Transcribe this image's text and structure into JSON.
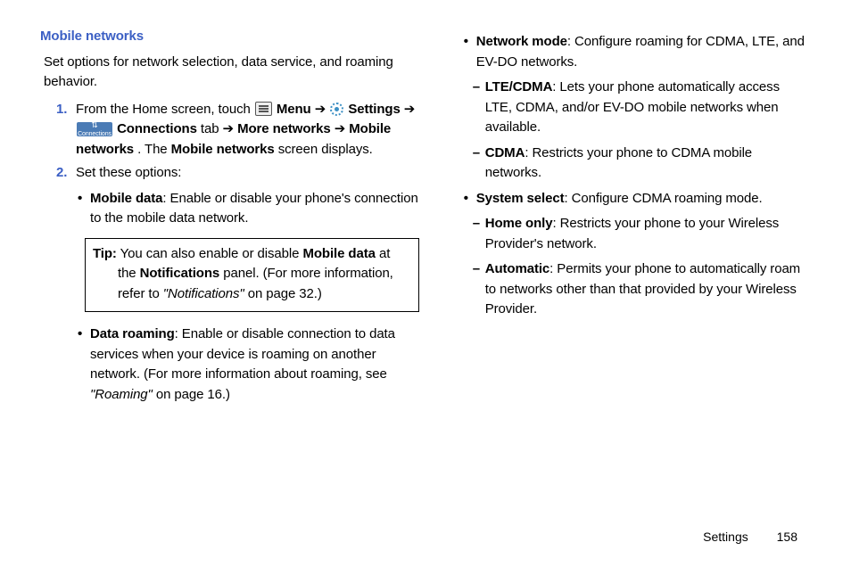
{
  "section_title": "Mobile networks",
  "intro": "Set options for network selection, data service, and roaming behavior.",
  "steps": {
    "s1": {
      "num": "1.",
      "segments": {
        "a": "From the Home screen, touch ",
        "menu": " Menu",
        "arr": " ➔ ",
        "settings": " Settings",
        "conn_tab": " Connections",
        "tab_word": " tab ",
        "more_net": "More networks",
        "mobile_net": "Mobile networks",
        "period": ". The ",
        "mobile_net2": "Mobile networks",
        "tail": " screen displays."
      }
    },
    "s2": {
      "num": "2.",
      "text": "Set these options:"
    }
  },
  "bullets_left": {
    "mobile_data": {
      "label": "Mobile data",
      "desc": ": Enable or disable your phone's connection to the mobile data network."
    },
    "data_roaming": {
      "label": "Data roaming",
      "desc_a": ": Enable or disable connection to data services when your device is roaming on another network. (For more information about roaming, see ",
      "ref": "\"Roaming\"",
      "desc_b": " on page 16.)"
    }
  },
  "tip": {
    "label": "Tip:",
    "text_a": " You can also enable or disable ",
    "bold1": "Mobile data",
    "text_b": " at the ",
    "bold2": "Notifications",
    "text_c": " panel. (For more information, refer to ",
    "ref": "\"Notifications\"",
    "text_d": " on page 32.)"
  },
  "bullets_right": {
    "network_mode": {
      "label": "Network mode",
      "desc": ": Configure roaming for CDMA, LTE, and EV-DO networks."
    },
    "lte_cdma": {
      "label": "LTE/CDMA",
      "desc": ": Lets your phone automatically access LTE, CDMA, and/or EV-DO mobile networks when available."
    },
    "cdma": {
      "label": "CDMA",
      "desc": ": Restricts your phone to CDMA mobile networks."
    },
    "system_select": {
      "label": "System select",
      "desc": ": Configure CDMA roaming mode."
    },
    "home_only": {
      "label": "Home only",
      "desc": ": Restricts your phone to your Wireless Provider's network."
    },
    "automatic": {
      "label": "Automatic",
      "desc": ": Permits your phone to automatically roam to networks other than that provided by your Wireless Provider."
    }
  },
  "footer": {
    "section": "Settings",
    "page": "158"
  },
  "conn_label": "Connections"
}
